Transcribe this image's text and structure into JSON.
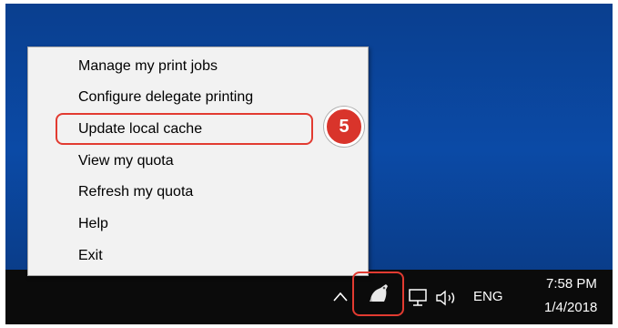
{
  "context_menu": {
    "items": [
      {
        "label": "Manage my print jobs"
      },
      {
        "label": "Configure delegate printing"
      },
      {
        "label": "Update local cache"
      },
      {
        "label": "View my quota"
      },
      {
        "label": "Refresh my quota"
      },
      {
        "label": "Help"
      },
      {
        "label": "Exit"
      }
    ]
  },
  "annotation": {
    "step_number": "5",
    "color": "#d9342b"
  },
  "taskbar": {
    "tray_icons": [
      "chevron-up-icon",
      "print-client-icon",
      "network-icon",
      "volume-icon"
    ],
    "language": "ENG",
    "time": "7:58 PM",
    "date": "1/4/2018"
  }
}
